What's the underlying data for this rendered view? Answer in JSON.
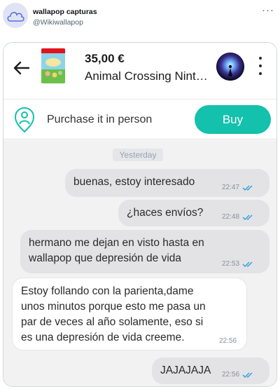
{
  "tweet": {
    "name": "wallapop capturas",
    "handle": "@Wikiwallapop",
    "more_icon": "more-horizontal-icon"
  },
  "chat": {
    "back_icon": "arrow-left-icon",
    "product": {
      "price": "35,00 €",
      "title": "Animal Crossing Nint…"
    },
    "menu_icon": "kebab-menu-icon",
    "purchase": {
      "icon": "location-person-icon",
      "label": "Purchase it in person",
      "buy_label": "Buy",
      "accent": "#13c1ac"
    },
    "day_separator": "Yesterday",
    "messages": [
      {
        "direction": "out",
        "text": "buenas, estoy interesado",
        "time": "22:47",
        "read": true
      },
      {
        "direction": "out",
        "text": "¿haces envíos?",
        "time": "22:48",
        "read": true
      },
      {
        "direction": "out",
        "line1": "hermano me dejan en visto hasta en",
        "line2": "wallapop que depresión de vida",
        "time": "22:53",
        "read": true
      },
      {
        "direction": "in",
        "line1": "Estoy follando con la parienta,dame",
        "line2": "unos minutos porque esto me pasa un",
        "line3": "par de veces al año solamente, eso si",
        "line4": "es una depresión de vida creeme.",
        "time": "22:56"
      },
      {
        "direction": "out",
        "text": "JAJAJAJA",
        "time": "22:56",
        "read": true
      }
    ],
    "tick_color": "#2f9fd8"
  }
}
